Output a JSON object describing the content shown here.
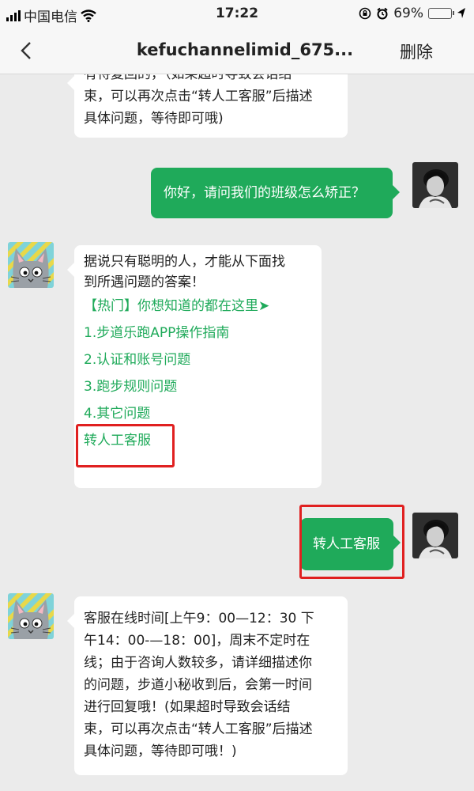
{
  "status_bar": {
    "carrier": "中国电信",
    "time": "17:22",
    "battery": "69%",
    "battery_level": 0.69
  },
  "nav": {
    "title": "kefuchannelimid_675...",
    "delete_label": "删除"
  },
  "messages": {
    "m1_lines": [
      "有待复回的，（如果超时导致会话结",
      "束，可以再次点击“转人工客服”后描述",
      "具体问题，等待即可哦)"
    ],
    "m2": "你好，请问我们的班级怎么矫正？",
    "m3_lines": [
      "据说只有聪明的人，才能从下面找",
      "到所遇问题的答案！"
    ],
    "m3_hot": "【热门】你想知道的都在这里➤",
    "m3_links": [
      "1.步道乐跑APP操作指南",
      "2.认证和账号问题",
      "3.跑步规则问题",
      "4.其它问题"
    ],
    "m3_transfer": "转人工客服",
    "m4": "转人工客服",
    "m5_lines": [
      "客服在线时间[上午9：00—12：30  下",
      "午14：00-—18：00]，周末不定时在",
      "线；由于咨询人数较多，请详细描述你",
      "的问题，步道小秘收到后，会第一时间",
      "进行回复哦！(如果超时导致会话结",
      "束，可以再次点击“转人工客服”后描述",
      "具体问题，等待即可哦！)"
    ]
  },
  "colors": {
    "bubble_out": "#1faa5a",
    "link_green": "#1faa5a",
    "link_blue": "#2a6fd6",
    "highlight": "#e02020"
  },
  "icons": [
    "back-icon",
    "wifi-icon",
    "lock-rotation-icon",
    "alarm-icon",
    "battery-icon",
    "location-icon",
    "cat-avatar",
    "user-avatar"
  ]
}
